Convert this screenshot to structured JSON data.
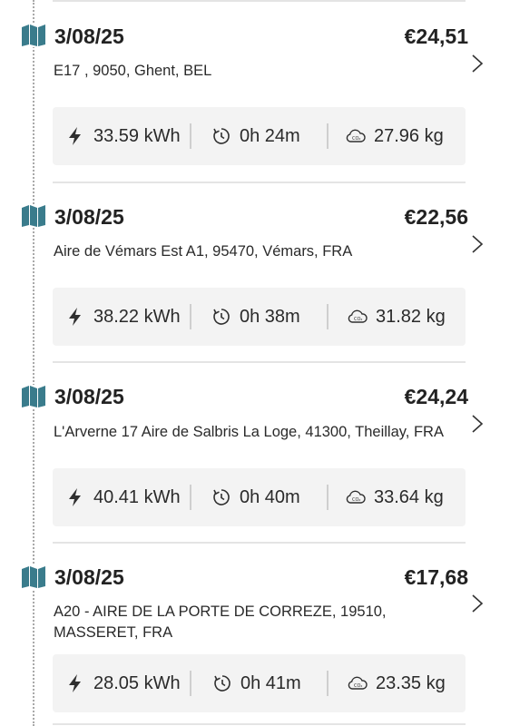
{
  "sessions": [
    {
      "date": "3/08/25",
      "price": "€24,51",
      "address": "E17 , 9050, Ghent, BEL",
      "energy": "33.59 kWh",
      "duration": "0h 24m",
      "co2": "27.96 kg"
    },
    {
      "date": "3/08/25",
      "price": "€22,56",
      "address": "Aire de Vémars Est A1, 95470, Vémars, FRA",
      "energy": "38.22 kWh",
      "duration": "0h 38m",
      "co2": "31.82 kg"
    },
    {
      "date": "3/08/25",
      "price": "€24,24",
      "address": "L'Arverne 17 Aire de Salbris La Loge, 41300, Theillay, FRA",
      "energy": "40.41 kWh",
      "duration": "0h 40m",
      "co2": "33.64 kg"
    },
    {
      "date": "3/08/25",
      "price": "€17,68",
      "address": "A20 - AIRE DE LA PORTE DE CORREZE, 19510, MASSERET, FRA",
      "energy": "28.05 kWh",
      "duration": "0h 41m",
      "co2": "23.35 kg"
    }
  ],
  "icons": {
    "session": "map-icon",
    "energy": "lightning-bolt-icon",
    "duration": "timer-icon",
    "co2": "co2-cloud-icon",
    "open": "chevron-right-icon"
  },
  "colors": {
    "map_icon": "#3a7c8c",
    "stats_background": "#f3f3f3"
  }
}
